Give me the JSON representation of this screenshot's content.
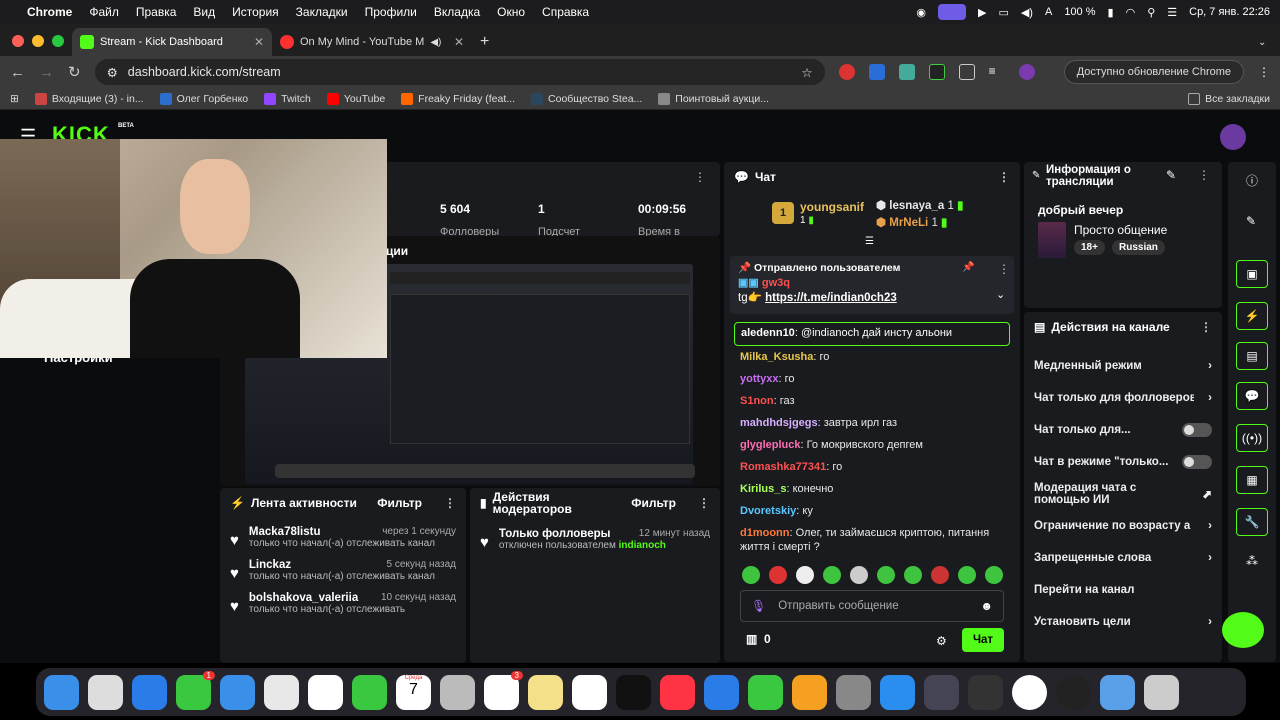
{
  "menubar": {
    "app": "Chrome",
    "items": [
      "Файл",
      "Правка",
      "Вид",
      "История",
      "Закладки",
      "Профили",
      "Вкладка",
      "Окно",
      "Справка"
    ],
    "battery": "100 %",
    "datetime": "Ср, 7 янв.  22:26"
  },
  "tabs": [
    {
      "title": "Stream - Kick Dashboard",
      "color": "#53fc18"
    },
    {
      "title": "On My Mind - YouTube M",
      "color": "#ff3030"
    }
  ],
  "url": "dashboard.kick.com/stream",
  "update_label": "Доступно обновление Chrome",
  "bookmarks": [
    {
      "label": "Входящие (3) - in...",
      "color": "#c44"
    },
    {
      "label": "Олег Горбенко",
      "color": "#2c6ecb"
    },
    {
      "label": "Twitch",
      "color": "#9147ff"
    },
    {
      "label": "YouTube",
      "color": "#f00"
    },
    {
      "label": "Freaky Friday (feat...",
      "color": "#f60"
    },
    {
      "label": "Сообщество Stea...",
      "color": "#2a475e"
    },
    {
      "label": "Поинтовый аукци...",
      "color": "#888"
    }
  ],
  "bookmarks_all": "Все закладки",
  "sidebar_label": "Настройки",
  "logo": "KICK",
  "logo_beta": "BETA",
  "stats": [
    {
      "value": "5 604",
      "label": "Фолловеры"
    },
    {
      "value": "1",
      "label": "Подсчет"
    },
    {
      "value": "00:09:56",
      "label": "Время в"
    }
  ],
  "preview_title": "ции",
  "activity": {
    "title": "Лента активности",
    "filter": "Фильтр",
    "items": [
      {
        "name": "Macka78listu",
        "time": "через 1 секунду",
        "text": "только что начал(-а) отслеживать канал"
      },
      {
        "name": "Linckaz",
        "time": "5 секунд назад",
        "text": "только что начал(-а) отслеживать канал"
      },
      {
        "name": "bolshakova_valeriia",
        "time": "10 секунд назад",
        "text": "только что начал(-а) отслеживать"
      }
    ]
  },
  "modactions": {
    "title": "Действия модераторов",
    "filter": "Фильтр",
    "item": {
      "title": "Только фолловеры",
      "time": "12 минут назад",
      "text": "отключен пользователем",
      "user": "indianoch"
    }
  },
  "chat": {
    "title": "Чат",
    "top": {
      "rank": "1",
      "user1": "youngsanif",
      "count1": "1",
      "user2": "lesnaya_a",
      "count2": "1",
      "user3": "MrNeLi",
      "count3": "1"
    },
    "pinned": {
      "label": "Отправлено пользователем",
      "user": "gw3q",
      "msg_prefix": "tg",
      "link": "https://t.me/indian0ch23"
    },
    "messages": [
      {
        "user": "aledenn10",
        "color": "#ffffff",
        "text": "@indianoch дай инсту альони"
      },
      {
        "user": "Milka_Ksusha",
        "color": "#e6c84a",
        "text": "го"
      },
      {
        "user": "yottyxx",
        "color": "#c86ef0",
        "text": "го"
      },
      {
        "user": "S1non",
        "color": "#ff5050",
        "text": "газ"
      },
      {
        "user": "mahdhdsjgegs",
        "color": "#d7b0ff",
        "text": "завтра ирл газ"
      },
      {
        "user": "glyglepluck",
        "color": "#ff6eb4",
        "text": "Го мокривского депгем"
      },
      {
        "user": "Romashka77341",
        "color": "#ff5050",
        "text": "го"
      },
      {
        "user": "Kirilus_s",
        "color": "#aaff5a",
        "text": "конечно"
      },
      {
        "user": "Dvoretskiy",
        "color": "#5ac8ff",
        "text": "ку"
      },
      {
        "user": "d1moonn",
        "color": "#ff7a3a",
        "text": "Олег, ти займаєшся криптою, питання життя і смерті ?"
      }
    ],
    "input_placeholder": "Отправить сообщение",
    "points": "0",
    "send": "Чат"
  },
  "info": {
    "title": "Информация о трансляции",
    "stream_title": "добрый вечер",
    "category": "Просто общение",
    "tags": [
      "18+",
      "Russian"
    ]
  },
  "channel_actions": {
    "title": "Действия на канале",
    "items": [
      {
        "label": "Медленный режим",
        "kind": "arrow"
      },
      {
        "label": "Чат только для фолловеров",
        "kind": "arrow"
      },
      {
        "label": "Чат только для...",
        "kind": "toggle"
      },
      {
        "label": "Чат в режиме \"только...",
        "kind": "toggle"
      },
      {
        "label": "Модерация чата с помощью ИИ",
        "kind": "ext"
      },
      {
        "label": "Ограничение по возрасту а",
        "kind": "arrow"
      },
      {
        "label": "Запрещенные слова",
        "kind": "arrow"
      },
      {
        "label": "Перейти на канал",
        "kind": "none"
      },
      {
        "label": "Установить цели",
        "kind": "arrow"
      }
    ]
  },
  "dock_date": {
    "month": "Среда",
    "day": "7"
  },
  "dock_badges": {
    "messages": "1",
    "reminders": "3"
  }
}
